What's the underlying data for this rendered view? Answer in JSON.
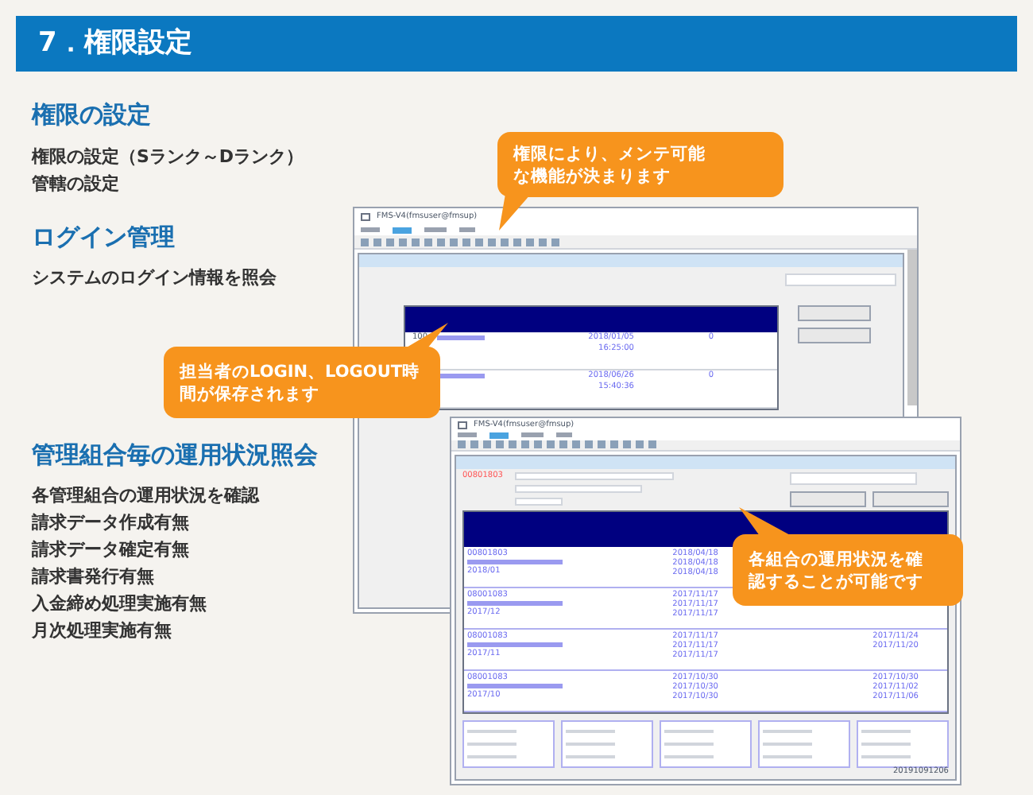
{
  "title": "7．権限設定",
  "sections": [
    {
      "heading": "権限の設定",
      "lines": [
        "権限の設定（Sランク～Dランク）",
        "管轄の設定"
      ]
    },
    {
      "heading": "ログイン管理",
      "lines": [
        "システムのログイン情報を照会"
      ]
    },
    {
      "heading": "管理組合毎の運用状況照会",
      "lines": [
        "各管理組合の運用状況を確認",
        "請求データ作成有無",
        "請求データ確定有無",
        "請求書発行有無",
        "入金締め処理実施有無",
        "月次処理実施有無"
      ]
    }
  ],
  "login_window": {
    "title": "FMS-V4(fmsuser@fmsup)",
    "rows": [
      {
        "number": "100",
        "login_date": "2018/01/05",
        "login_time": "16:25:00",
        "process_no": "0"
      },
      {
        "number": "",
        "login_date": "2018/06/26",
        "login_time": "15:40:36",
        "process_no": "0"
      }
    ]
  },
  "status_window": {
    "title": "FMS-V4(fmsuser@fmsup)",
    "code": "00801803",
    "status_time": "20191091206",
    "rows": [
      {
        "code": "00801803",
        "month": "2018/01",
        "dates": [
          "2018/04/18",
          "2018/04/18",
          "2018/04/18"
        ],
        "late_dates": []
      },
      {
        "code": "08001083",
        "month": "2017/12",
        "dates": [
          "2017/11/17",
          "2017/11/17",
          "2017/11/17"
        ],
        "late_dates": []
      },
      {
        "code": "08001083",
        "month": "2017/11",
        "dates": [
          "2017/11/17",
          "2017/11/17",
          "2017/11/17"
        ],
        "late_dates": [
          "2017/11/24",
          "2017/11/20"
        ]
      },
      {
        "code": "08001083",
        "month": "2017/10",
        "dates": [
          "2017/10/30",
          "2017/10/30",
          "2017/10/30"
        ],
        "late_dates": [
          "2017/10/30",
          "2017/11/02",
          "2017/11/06"
        ]
      }
    ]
  },
  "callouts": [
    {
      "text": "権限により、メンテ可能な機能が決まります"
    },
    {
      "text": "担当者のLOGIN、LOGOUT時間が保存されます"
    },
    {
      "text": "各組合の運用状況を確認することが可能です"
    }
  ]
}
